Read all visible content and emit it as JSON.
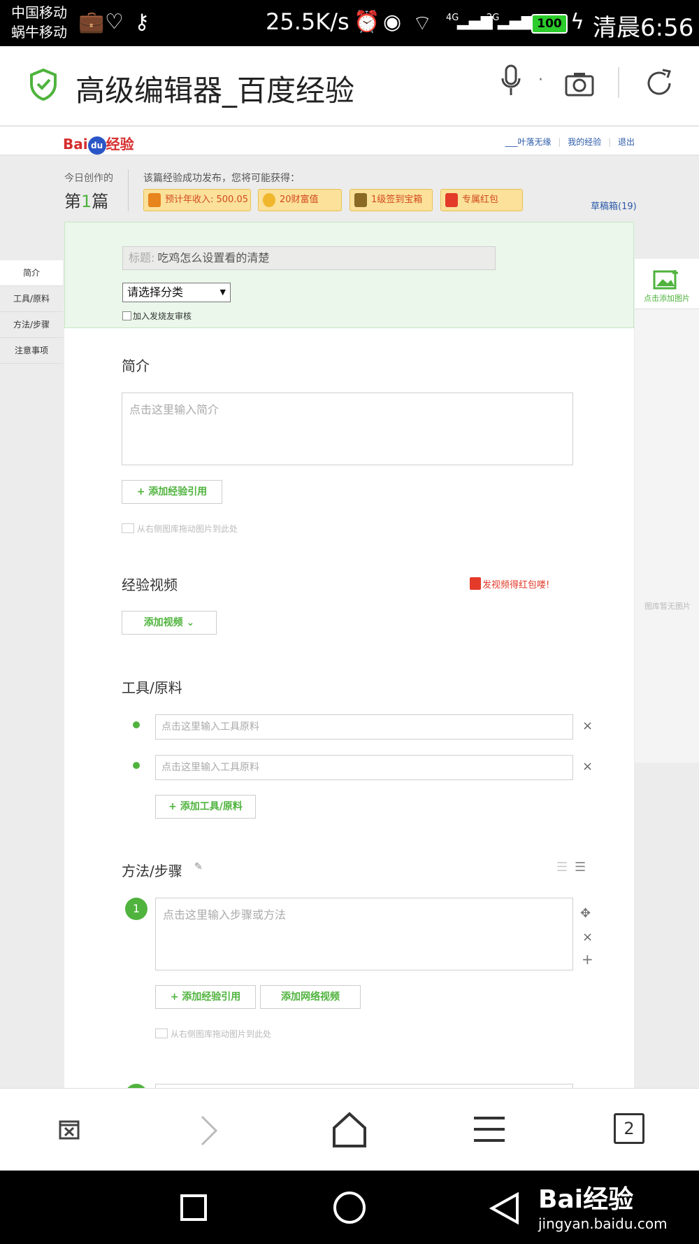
{
  "status_bar": {
    "carrier1": "中国移动",
    "carrier2": "蜗牛移动",
    "speed": "25.5K/s",
    "net1": "4G",
    "net2": "2G",
    "battery": "100",
    "time": "清晨6:56"
  },
  "browser": {
    "title": "高级编辑器_百度经验"
  },
  "site": {
    "logo_text": "Bai",
    "logo_paw": "du",
    "logo_suffix": "经验",
    "links": [
      "___叶落无缘",
      "我的经验",
      "退出"
    ]
  },
  "stats": {
    "today_label": "今日创作的",
    "today_count_pre": "第",
    "today_count_num": "1",
    "today_count_post": "篇",
    "reward_label": "该篇经验成功发布，您将可能获得：",
    "rewards": [
      "预计年收入: 500.05",
      "20财富值",
      "1级签到宝箱",
      "专属红包"
    ],
    "drafts": "草稿箱(19)"
  },
  "form": {
    "title_prefix": "标题:",
    "title_value": "吃鸡怎么设置看的清楚",
    "category": "请选择分类",
    "checkbox_label": "加入发烧友审核"
  },
  "sidenav": [
    "简介",
    "工具/原料",
    "方法/步骤",
    "注意事项"
  ],
  "sections": {
    "intro": {
      "heading": "简介",
      "placeholder": "点击这里输入简介",
      "add_ref": "+ 添加经验引用",
      "drag_hint": "从右侧图库拖动图片到此处"
    },
    "video": {
      "heading": "经验视频",
      "promo": "发视频得红包喽!",
      "add_video": "添加视频 ⌄"
    },
    "tools": {
      "heading": "工具/原料",
      "placeholder": "点击这里输入工具原料",
      "add_tool": "+ 添加工具/原料"
    },
    "steps": {
      "heading": "方法/步骤",
      "step_num": "1",
      "placeholder": "点击这里输入步骤或方法",
      "add_ref": "+ 添加经验引用",
      "add_net_video": "添加网络视频",
      "drag_hint": "从右侧图库拖动图片到此处"
    }
  },
  "gallery": {
    "add_label": "点击添加图片",
    "empty": "图库暂无图片"
  },
  "bottom_bar": {
    "tabs_count": "2"
  },
  "watermark": {
    "brand": "Bai经验",
    "url": "jingyan.baidu.com"
  },
  "colors": {
    "accent": "#4fb33d",
    "reward_bg": "#fbe19a",
    "link": "#2b5aa8"
  }
}
